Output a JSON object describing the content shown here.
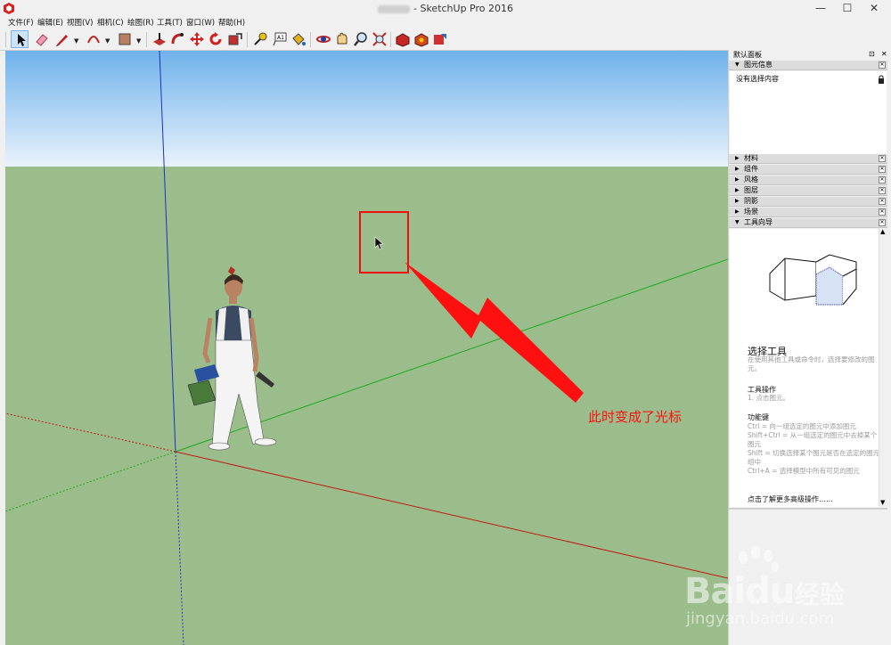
{
  "window": {
    "title": "- SketchUp Pro 2016",
    "buttons": {
      "minimize": "—",
      "maximize": "☐",
      "close": "✕"
    }
  },
  "menu": [
    "文件(F)",
    "编辑(E)",
    "视图(V)",
    "相机(C)",
    "绘图(R)",
    "工具(T)",
    "窗口(W)",
    "帮助(H)"
  ],
  "toolbar": {
    "icons": [
      "select-icon",
      "eraser-icon",
      "pencil-icon",
      "arc-icon",
      "rectangle-icon",
      "push-pull-icon",
      "follow-me-icon",
      "move-icon",
      "rotate-icon",
      "scale-icon",
      "tape-measure-icon",
      "text-icon",
      "paint-bucket-icon",
      "orbit-icon",
      "pan-icon",
      "zoom-icon",
      "zoom-extents-icon",
      "3d-warehouse-icon",
      "extension-warehouse-icon",
      "layout-icon"
    ],
    "active": "select-icon"
  },
  "panel": {
    "title": "默认面板",
    "pin": "⊡",
    "entity_info": {
      "label": "图元信息",
      "status": "没有选择内容"
    },
    "sections": [
      "材料",
      "组件",
      "风格",
      "图层",
      "阴影",
      "场景"
    ],
    "instructor": {
      "label": "工具向导",
      "tool_name": "选择工具",
      "tool_desc": "在使用其他工具或命令时，选择要修改的图元。",
      "ops_title": "工具操作",
      "ops": [
        "1.    点击图元。"
      ],
      "keys_title": "功能键",
      "keys": [
        "Ctrl = 向一组选定的图元中添加图元",
        "Shift+Ctrl = 从一组选定的图元中去掉某个图元",
        "Shift = 切换选择某个图元是否在选定的图元组中",
        "Ctrl+A = 选择模型中所有可见的图元"
      ],
      "more_link": "点击了解更多高级操作……"
    }
  },
  "annotation": {
    "text": "此时变成了光标",
    "color": "#ff1010"
  },
  "watermark": {
    "brand": "Bai",
    "brand2": "du",
    "cn": "经验",
    "url": "jingyan.baidu.com"
  },
  "colors": {
    "sky_top": "#6fb1ea",
    "sky_bottom": "#e9f3fb",
    "ground": "#9bbd8c",
    "axis_red": "#c01818",
    "axis_green": "#20a820",
    "axis_blue": "#2030c0"
  }
}
